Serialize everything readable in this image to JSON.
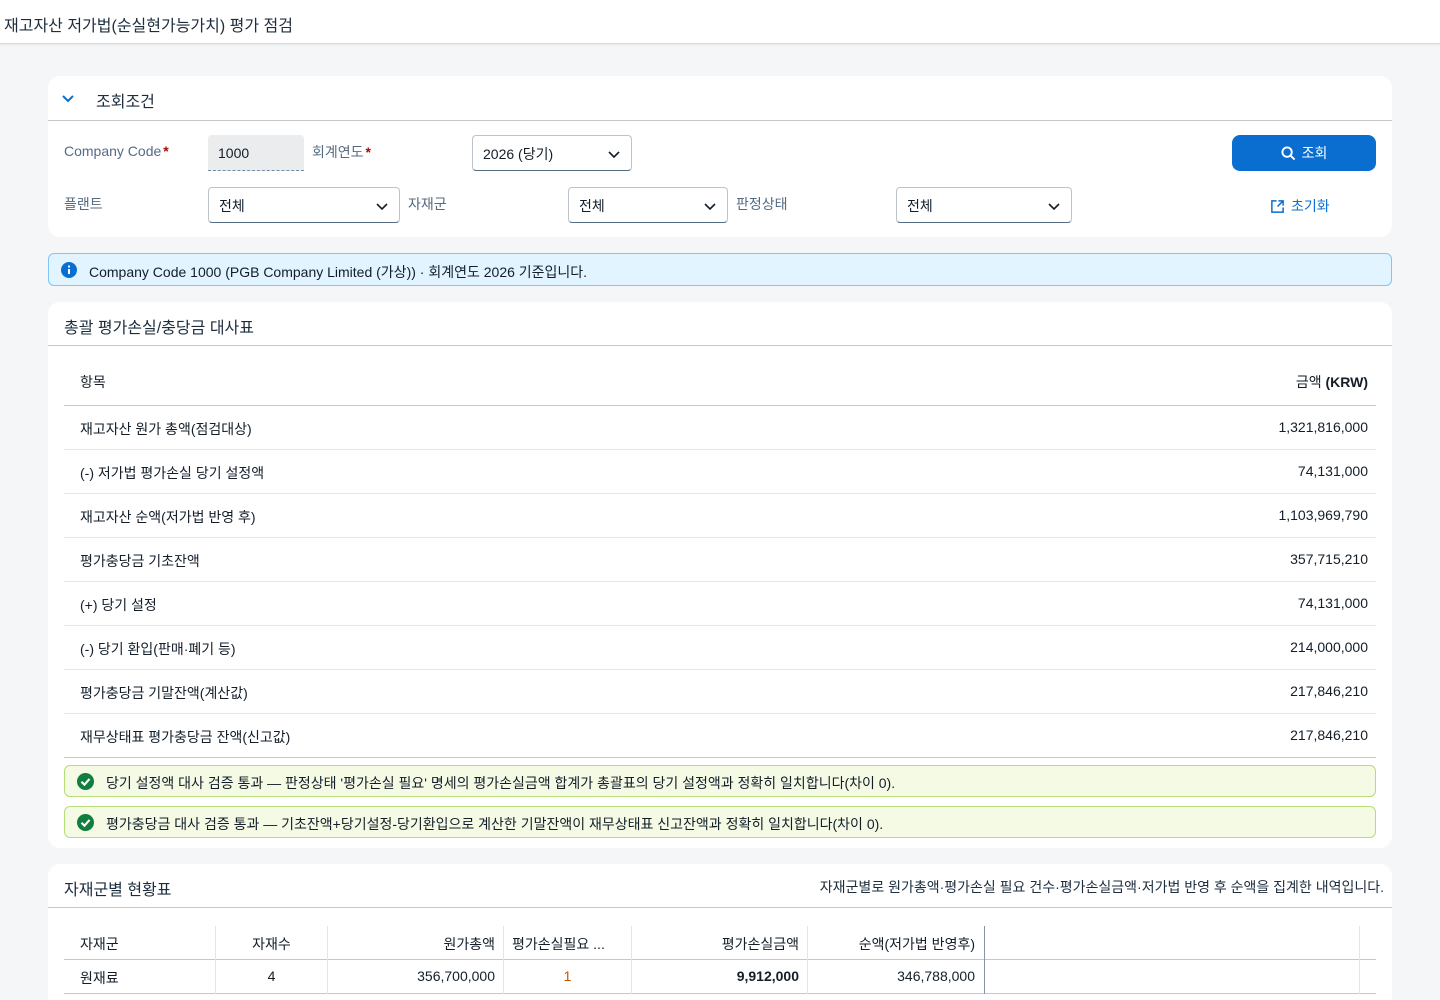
{
  "page": {
    "title": "재고자산 저가법(순실현가능가치) 평가 점검"
  },
  "filter": {
    "title": "조회조건",
    "company_code": {
      "label": "Company Code",
      "value": "1000",
      "required": true
    },
    "fiscal_year": {
      "label": "회계연도",
      "value": "2026 (당기)",
      "required": true
    },
    "plant": {
      "label": "플랜트",
      "value": "전체"
    },
    "material_group": {
      "label": "자재군",
      "value": "전체"
    },
    "judgement_status": {
      "label": "판정상태",
      "value": "전체"
    },
    "search_label": "조회",
    "reset_label": "초기화"
  },
  "info_strip": {
    "text": "Company Code 1000 (PGB Company Limited (가상)) · 회계연도 2026 기준입니다."
  },
  "summary": {
    "title": "총괄 평가손실/충당금 대사표",
    "col_item": "항목",
    "col_amount_prefix": "금액 ",
    "col_amount_unit": "(KRW)",
    "rows": [
      {
        "item": "재고자산 원가 총액(점검대상)",
        "amount": "1,321,816,000"
      },
      {
        "item": "(-) 저가법 평가손실 당기 설정액",
        "amount": "74,131,000"
      },
      {
        "item": "재고자산 순액(저가법 반영 후)",
        "amount": "1,103,969,790"
      },
      {
        "item": "평가충당금 기초잔액",
        "amount": "357,715,210"
      },
      {
        "item": "(+) 당기 설정",
        "amount": "74,131,000"
      },
      {
        "item": "(-) 당기 환입(판매·폐기 등)",
        "amount": "214,000,000"
      },
      {
        "item": "평가충당금 기말잔액(계산값)",
        "amount": "217,846,210"
      },
      {
        "item": "재무상태표 평가충당금 잔액(신고값)",
        "amount": "217,846,210"
      }
    ],
    "checks": [
      "당기 설정액 대사 검증 통과 — 판정상태 '평가손실 필요' 명세의 평가손실금액 합계가 총괄표의 당기 설정액과 정확히 일치합니다(차이 0).",
      "평가충당금 대사 검증 통과 — 기초잔액+당기설정-당기환입으로 계산한 기말잔액이 재무상태표 신고잔액과 정확히 일치합니다(차이 0)."
    ],
    "status_color": "#107e3e"
  },
  "material_groups": {
    "title": "자재군별 현황표",
    "description": "자재군별로 원가총액·평가손실 필요 건수·평가손실금액·저가법 반영 후 순액을 집계한 내역입니다.",
    "columns": [
      "자재군",
      "자재수",
      "원가총액",
      "평가손실필요 ...",
      "평가손실금액",
      "순액(저가법 반영후)"
    ],
    "rows": [
      {
        "group": "원재료",
        "count": "4",
        "cost": "356,700,000",
        "loss_needed": "1",
        "loss_amount": "9,912,000",
        "net": "346,788,000"
      }
    ]
  },
  "colors": {
    "accent": "#0a6ed1",
    "warning": "#c35500",
    "required": "#aa0808"
  }
}
